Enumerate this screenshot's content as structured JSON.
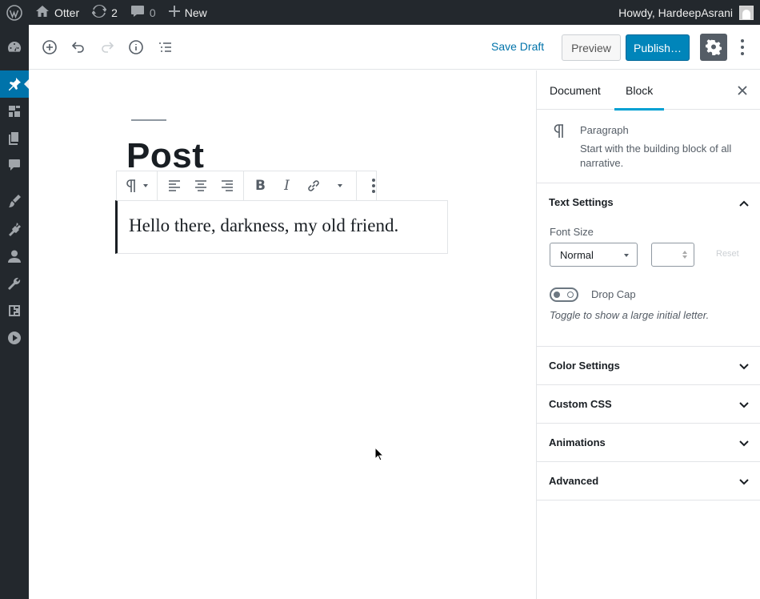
{
  "admin_bar": {
    "site_name": "Otter",
    "updates_count": "2",
    "comments_count": "0",
    "new_label": "New",
    "greeting": "Howdy, HardeepAsrani"
  },
  "admin_menu": {
    "items": [
      "dashboard-icon",
      "posts-icon",
      "media-icon",
      "pages-icon",
      "comments-icon",
      "appearance-icon",
      "plugins-icon",
      "users-icon",
      "tools-icon",
      "settings-icon",
      "video-icon"
    ],
    "active": "posts-icon"
  },
  "header": {
    "save_draft": "Save Draft",
    "preview": "Preview",
    "publish": "Publish…"
  },
  "editor": {
    "post_title": "Post",
    "paragraph_text": "Hello there, darkness, my old friend."
  },
  "sidebar": {
    "tabs": [
      {
        "label": "Document",
        "active": false
      },
      {
        "label": "Block",
        "active": true
      }
    ],
    "block": {
      "name": "Paragraph",
      "description": "Start with the building block of all narrative."
    },
    "text_settings": {
      "title": "Text Settings",
      "font_size_label": "Font Size",
      "font_size_value": "Normal",
      "custom_size_value": "",
      "reset_label": "Reset",
      "drop_cap_label": "Drop Cap",
      "drop_cap_help": "Toggle to show a large initial letter.",
      "drop_cap_enabled": false
    },
    "panels": [
      {
        "title": "Color Settings"
      },
      {
        "title": "Custom CSS"
      },
      {
        "title": "Animations"
      },
      {
        "title": "Advanced"
      }
    ]
  },
  "colors": {
    "admin_bg": "#23282d",
    "accent": "#0073aa",
    "publish": "#0085ba",
    "tab_underline": "#00a0d2"
  }
}
